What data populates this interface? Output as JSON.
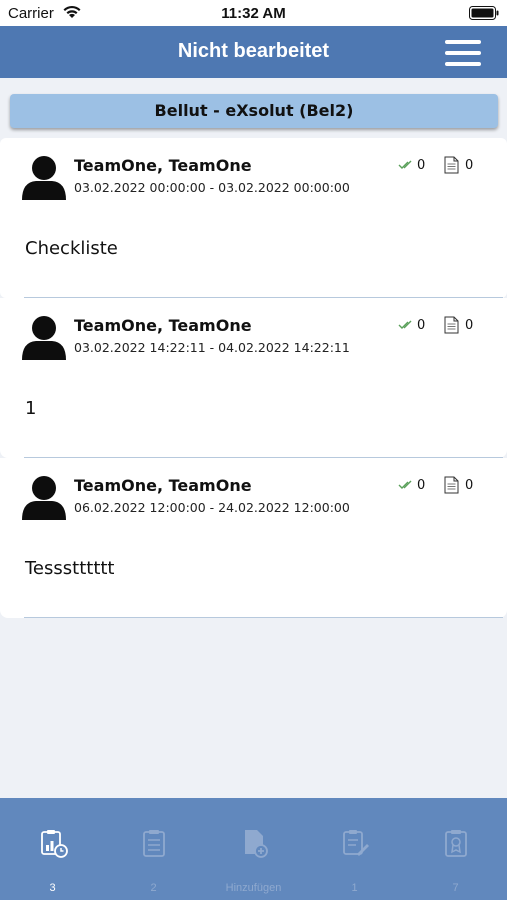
{
  "status_bar": {
    "carrier": "Carrier",
    "time": "11:32 AM"
  },
  "nav": {
    "title": "Nicht bearbeitet",
    "icon": "hamburger-menu-icon"
  },
  "context_header": {
    "label": "Bellut - eXsolut (Bel2)"
  },
  "entries": [
    {
      "name": "TeamOne, TeamOne",
      "date_range": "03.02.2022 00:00:00 - 03.02.2022 00:00:00",
      "checks": "0",
      "docs": "0",
      "text": "Checkliste"
    },
    {
      "name": "TeamOne, TeamOne",
      "date_range": "03.02.2022 14:22:11 - 04.02.2022 14:22:11",
      "checks": "0",
      "docs": "0",
      "text": "1"
    },
    {
      "name": "TeamOne, TeamOne",
      "date_range": "06.02.2022 12:00:00 - 24.02.2022 12:00:00",
      "checks": "0",
      "docs": "0",
      "text": "Tessstttttt"
    }
  ],
  "tabs": [
    {
      "label": "3",
      "icon": "checklist-clock-icon",
      "active": true
    },
    {
      "label": "2",
      "icon": "clipboard-icon",
      "active": false
    },
    {
      "label": "Hinzufügen",
      "icon": "add-document-icon",
      "active": false
    },
    {
      "label": "1",
      "icon": "clipboard-edit-icon",
      "active": false
    },
    {
      "label": "7",
      "icon": "clipboard-badge-icon",
      "active": false
    }
  ],
  "colors": {
    "nav": "#4e78b2",
    "tab_bar": "#6188bd",
    "header": "#9cc0e4",
    "check": "#5aa05a"
  }
}
